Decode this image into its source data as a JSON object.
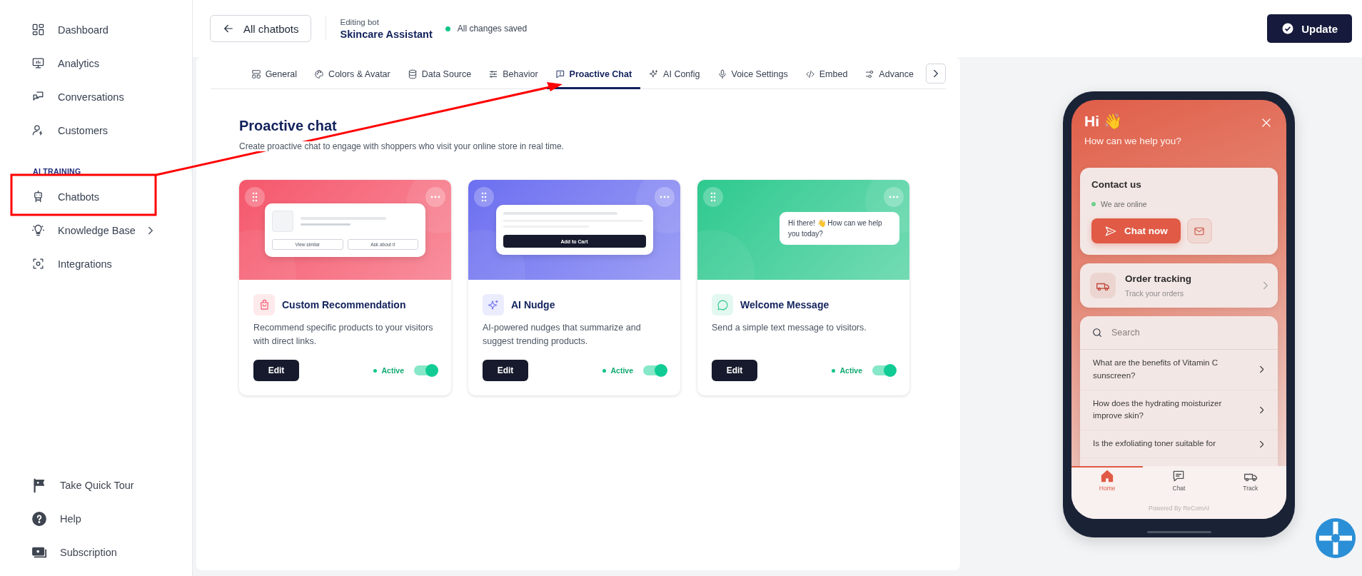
{
  "sidebar": {
    "items": [
      {
        "label": "Dashboard",
        "has_submenu": false
      },
      {
        "label": "Analytics",
        "has_submenu": false
      },
      {
        "label": "Conversations",
        "has_submenu": false
      },
      {
        "label": "Customers",
        "has_submenu": false
      }
    ],
    "section_label": "AI TRAINING",
    "section_items": [
      {
        "label": "Chatbots",
        "has_submenu": false
      },
      {
        "label": "Knowledge Base",
        "has_submenu": true
      },
      {
        "label": "Integrations",
        "has_submenu": false
      }
    ],
    "footer_items": [
      {
        "label": "Take Quick Tour"
      },
      {
        "label": "Help"
      },
      {
        "label": "Subscription"
      }
    ]
  },
  "header": {
    "back_button": "All chatbots",
    "editing_label": "Editing bot",
    "bot_name": "Skincare Assistant",
    "save_status": "All changes saved",
    "update_button": "Update"
  },
  "tabs": [
    {
      "label": "General",
      "selected": false
    },
    {
      "label": "Colors & Avatar",
      "selected": false
    },
    {
      "label": "Data Source",
      "selected": false
    },
    {
      "label": "Behavior",
      "selected": false
    },
    {
      "label": "Proactive Chat",
      "selected": true
    },
    {
      "label": "AI Config",
      "selected": false
    },
    {
      "label": "Voice Settings",
      "selected": false
    },
    {
      "label": "Embed",
      "selected": false
    },
    {
      "label": "Advance",
      "selected": false
    }
  ],
  "page": {
    "title": "Proactive chat",
    "subtitle": "Create proactive chat to engage with shoppers who visit your online store in real time."
  },
  "cards": [
    {
      "kind": "product",
      "color": "#f5576c",
      "title": "Custom Recommendation",
      "description": "Recommend specific products to your visitors with direct links.",
      "preview_buttons": [
        "View similar",
        "Ask about it"
      ],
      "edit_button": "Edit",
      "status": "Active",
      "on": true
    },
    {
      "kind": "nudge",
      "color": "#6c6ff0",
      "title": "AI Nudge",
      "description": "AI-powered nudges that summarize and suggest trending products.",
      "preview_buttons": [
        "Add to Cart"
      ],
      "edit_button": "Edit",
      "status": "Active",
      "on": true
    },
    {
      "kind": "message",
      "color": "#2ec98f",
      "title": "Welcome Message",
      "description": "Send a simple text message to visitors.",
      "preview_message": "Hi there! 👋 How can we help you today?",
      "edit_button": "Edit",
      "status": "Active",
      "on": true
    }
  ],
  "widget": {
    "greeting": "Hi 👋",
    "subtitle": "How can we help you?",
    "contact": {
      "title": "Contact us",
      "status": "We are online",
      "chat_button": "Chat now"
    },
    "order": {
      "title": "Order tracking",
      "subtitle": "Track your orders"
    },
    "search": {
      "placeholder": "Search"
    },
    "faqs": [
      "What are the benefits of Vitamin C sunscreen?",
      "How does the hydrating moisturizer improve skin?",
      "Is the exfoliating toner suitable for"
    ],
    "nav": [
      {
        "label": "Home",
        "selected": true
      },
      {
        "label": "Chat",
        "selected": false
      },
      {
        "label": "Track",
        "selected": false
      }
    ],
    "powered_by": "Powered By ReComAI"
  }
}
